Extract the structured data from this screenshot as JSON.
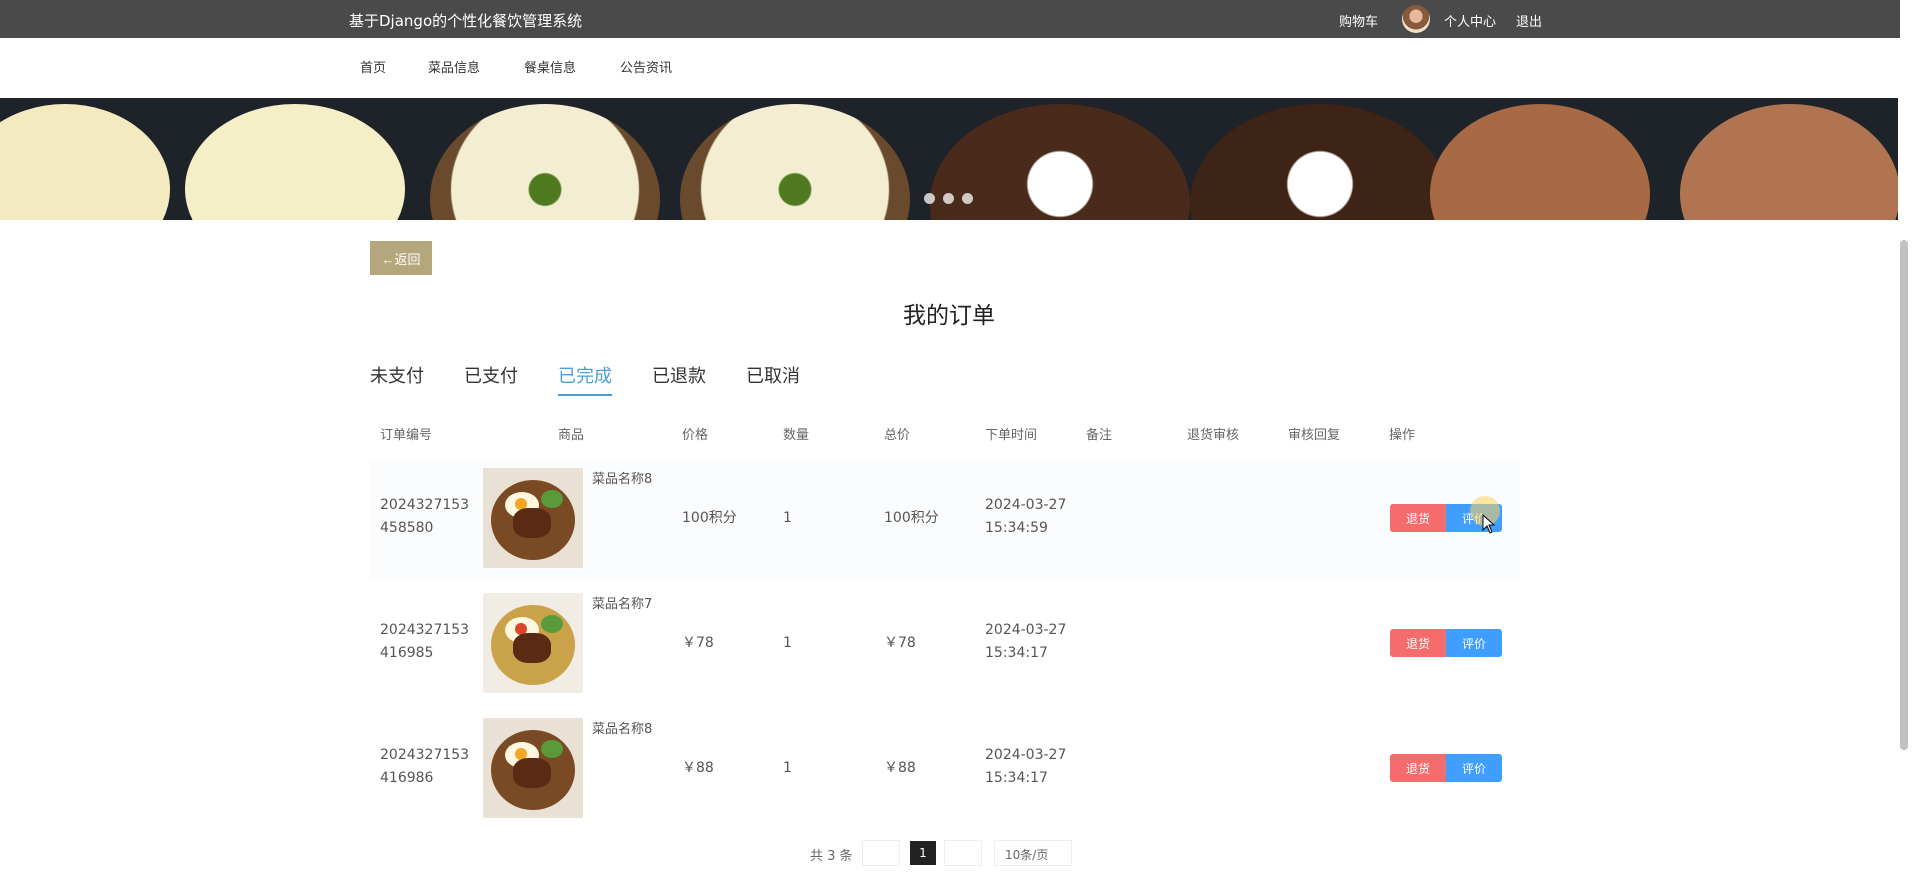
{
  "header": {
    "title": "基于Django的个性化餐饮管理系统",
    "cart": "购物车",
    "user_center": "个人中心",
    "logout": "退出"
  },
  "nav": {
    "items": [
      "首页",
      "菜品信息",
      "餐桌信息",
      "公告资讯"
    ]
  },
  "back_label": "←返回",
  "page_title": "我的订单",
  "tabs": [
    "未支付",
    "已支付",
    "已完成",
    "已退款",
    "已取消"
  ],
  "active_tab": "已完成",
  "table": {
    "headers": [
      "订单编号",
      "商品",
      "价格",
      "数量",
      "总价",
      "下单时间",
      "备注",
      "退货审核",
      "审核回复",
      "操作"
    ],
    "rows": [
      {
        "order_no_line1": "2024327153",
        "order_no_line2": "458580",
        "product": "菜品名称8",
        "price": "100积分",
        "qty": "1",
        "total": "100积分",
        "date": "2024-03-27",
        "time": "15:34:59",
        "refund": "退货",
        "review": "评价"
      },
      {
        "order_no_line1": "2024327153",
        "order_no_line2": "416985",
        "product": "菜品名称7",
        "price": "￥78",
        "qty": "1",
        "total": "￥78",
        "date": "2024-03-27",
        "time": "15:34:17",
        "refund": "退货",
        "review": "评价"
      },
      {
        "order_no_line1": "2024327153",
        "order_no_line2": "416986",
        "product": "菜品名称8",
        "price": "￥88",
        "qty": "1",
        "total": "￥88",
        "date": "2024-03-27",
        "time": "15:34:17",
        "refund": "退货",
        "review": "评价"
      }
    ]
  },
  "pagination": {
    "total": "共 3 条",
    "current": "1",
    "page_size": "10条/页"
  },
  "colors": {
    "topbar": "#4a4a4a",
    "back_button": "#b5a77c",
    "active_tab": "#4a9fd8",
    "refund_button": "#f56c6c",
    "review_button": "#409eff"
  }
}
